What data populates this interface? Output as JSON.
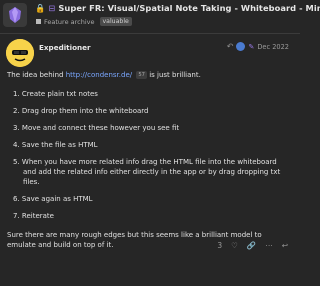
{
  "topic": {
    "title": "Super FR: Visual/Spatial Note Taking - Whiteboard - Min...",
    "category": "Feature archive",
    "badge": "valuable"
  },
  "post": {
    "author": "Expeditioner",
    "date": "Dec 2022",
    "intro_prefix": "The idea behind ",
    "link_text": "http://condensr.de/",
    "link_count": "57",
    "intro_suffix": " is just brilliant.",
    "steps": [
      "1. Create plain txt notes",
      "2. Drag drop them into the whiteboard",
      "3. Move and connect these however you see fit",
      "4. Save the file as HTML",
      "5. When you have more related info drag the HTML file into the whiteboard",
      "and add the related info either directly in the app or by drag dropping txt",
      "files.",
      "6. Save again as HTML",
      "7. Reiterate"
    ],
    "closing_line1": "Sure there are many rough edges but this seems like a brilliant model to",
    "closing_line2": "emulate and build on top of it.",
    "like_count": "3"
  },
  "colors": {
    "background": "#262626",
    "accent": "#9b7be8",
    "link": "#7aa7ff",
    "avatar": "#f7d24a"
  },
  "icons": [
    "app-logo-icon",
    "lock-icon",
    "category-icon",
    "reply-arrow-icon",
    "pin-icon",
    "like-icon",
    "link-icon",
    "more-icon",
    "reply-icon"
  ]
}
